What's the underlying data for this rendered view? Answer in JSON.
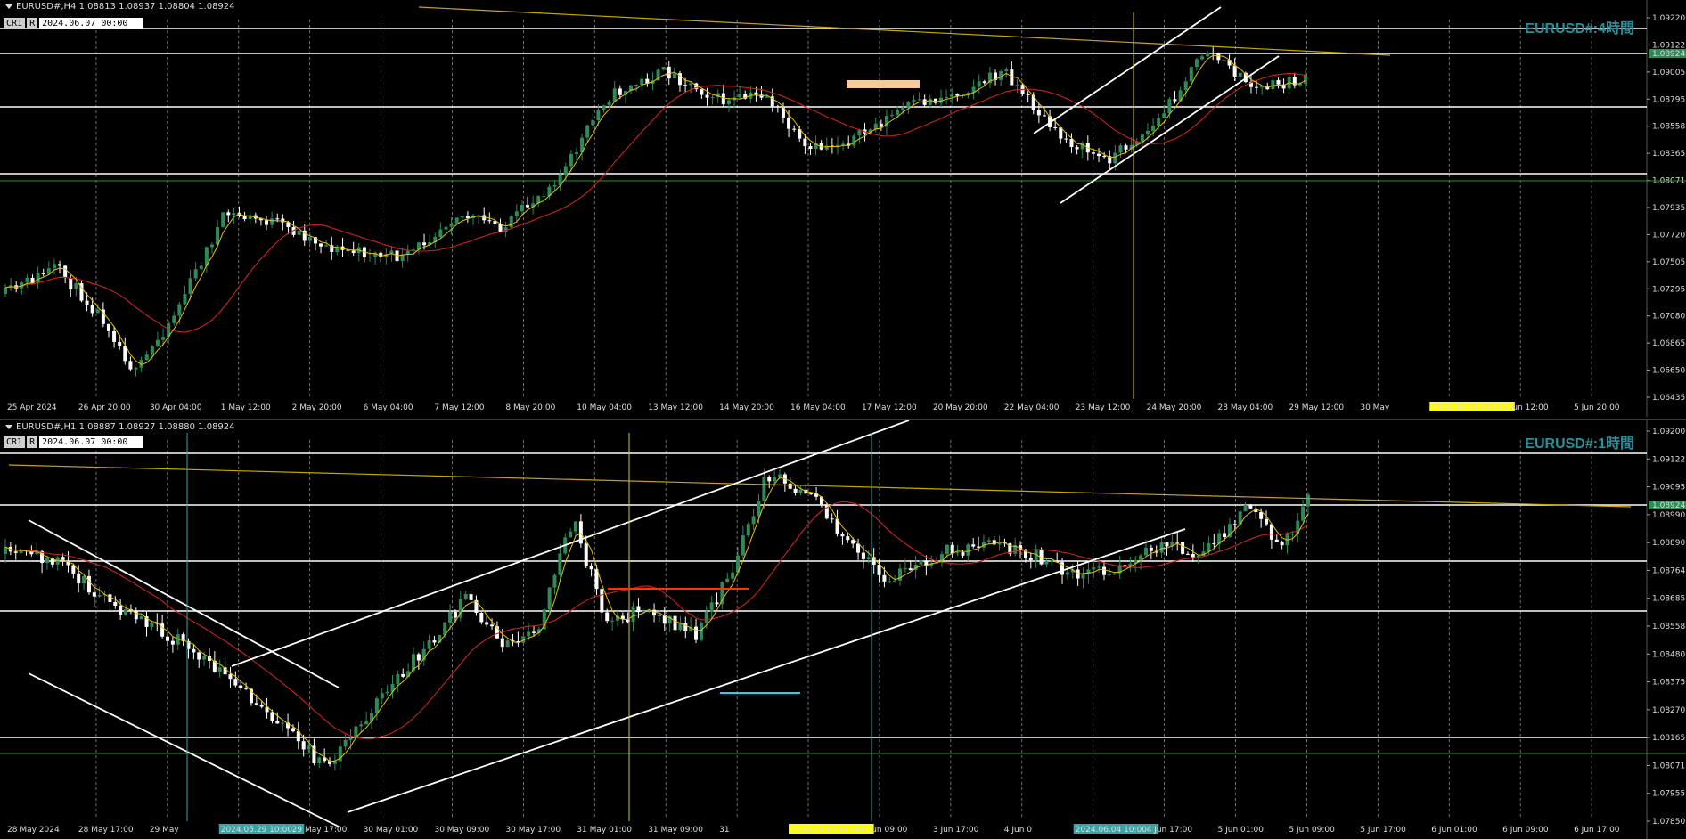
{
  "colors": {
    "background": "#000000",
    "bull": "#2e8b57",
    "bear": "#ffffff",
    "ma_slow": "#cc2222",
    "ma_fast": "#e8c000",
    "hline": "#ffffff",
    "channel": "#ffffff",
    "trend_gold": "#c8a800",
    "grid": "#8a8a8a",
    "label_accent": "#2a8f9a",
    "highlight": "#ffff00"
  },
  "h4": {
    "header": "EURUSD#,H4  1.08813 1.08937 1.08804 1.08924",
    "tag_cr": "CR1",
    "tag_r": "R",
    "tag_date": "2024.06.07 00:00",
    "symbol_label": "EURUSD#:4時間",
    "y_labels": [
      "1.09220",
      "1.09122",
      "1.09005",
      "1.08795",
      "1.08558",
      "1.08365",
      "1.08071",
      "1.07935",
      "1.07720",
      "1.07505",
      "1.07295",
      "1.07080",
      "1.06865",
      "1.06650",
      "1.06435"
    ],
    "y_highlight": "1.08924",
    "x_labels": [
      "25 Apr 2024",
      "26 Apr 20:00",
      "30 Apr 04:00",
      "1 May 12:00",
      "2 May 20:00",
      "6 May 04:00",
      "7 May 12:00",
      "8 May 20:00",
      "10 May 04:00",
      "13 May 12:00",
      "14 May 20:00",
      "16 May 04:00",
      "17 May 12:00",
      "20 May 20:00",
      "22 May 04:00",
      "23 May 12:00",
      "24 May 20:00",
      "28 May 04:00",
      "29 May 12:00",
      "30 May",
      "2024.06.03 00:00",
      "4 Jun 12:00",
      "5 Jun 20:00"
    ],
    "tool_icon": "pencil-cross-icon"
  },
  "h1": {
    "header": "EURUSD#,H1  1.08887 1.08927 1.08880 1.08924",
    "tag_cr": "CR1",
    "tag_r": "R",
    "tag_date": "2024.06.07 00:00",
    "symbol_label": "EURUSD#:1時間",
    "y_labels": [
      "1.09200",
      "1.09122",
      "1.09095",
      "1.08990",
      "1.08890",
      "1.08764",
      "1.08685",
      "1.08558",
      "1.08480",
      "1.08375",
      "1.08270",
      "1.08165",
      "1.08071",
      "1.07955",
      "1.07850"
    ],
    "y_highlight": "1.08924",
    "x_labels": [
      "28 May 2024",
      "28 May 17:00",
      "29 May",
      "2024.05.29 10:00",
      "29 May 17:00",
      "30 May 01:00",
      "30 May 09:00",
      "30 May 17:00",
      "31 May 01:00",
      "31 May 09:00",
      "31",
      "2024.06.03 00:00",
      "3 Jun 09:00",
      "3 Jun 17:00",
      "4 Jun 0",
      "2024.06.04 10:00",
      "4 Jun 17:00",
      "5 Jun 01:00",
      "5 Jun 09:00",
      "5 Jun 17:00",
      "6 Jun 01:00",
      "6 Jun 09:00",
      "6 Jun 17:00"
    ]
  }
}
